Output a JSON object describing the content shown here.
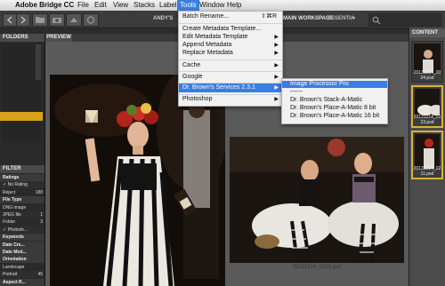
{
  "menubar": {
    "apple_glyph": "",
    "app": "Adobe Bridge CC",
    "items": [
      "File",
      "Edit",
      "View",
      "Stacks",
      "Label",
      "Tools",
      "Window",
      "Help"
    ]
  },
  "toolbar": {
    "breadcrumb": "ANDY'S",
    "workspace": "MAIN WORKSPACE",
    "workspace2": "ESSENTIA",
    "dropdown_glyph": "▾"
  },
  "left_panel": {
    "folders_tab": "FOLDERS",
    "filter_tab": "FILTER",
    "rows": [
      {
        "label": "Ratings",
        "count": "",
        "kind": "cat"
      },
      {
        "label": "✓ No Rating",
        "count": "",
        "kind": "row"
      },
      {
        "label": "Reject",
        "count": "188",
        "kind": "row"
      },
      {
        "label": "File Type",
        "count": "",
        "kind": "cat"
      },
      {
        "label": "DNG image",
        "count": "",
        "kind": "row"
      },
      {
        "label": "JPEG file",
        "count": "1",
        "kind": "row"
      },
      {
        "label": "Folder",
        "count": "3",
        "kind": "row"
      },
      {
        "label": "✓ Photosh...",
        "count": "",
        "kind": "row"
      },
      {
        "label": "Keywords",
        "count": "",
        "kind": "cat"
      },
      {
        "label": "Date Cre...",
        "count": "",
        "kind": "cat"
      },
      {
        "label": "Date Mod...",
        "count": "",
        "kind": "cat"
      },
      {
        "label": "Orientation",
        "count": "",
        "kind": "cat"
      },
      {
        "label": "Landscape",
        "count": "",
        "kind": "row"
      },
      {
        "label": "Portrait",
        "count": "45",
        "kind": "row"
      },
      {
        "label": "Aspect R...",
        "count": "",
        "kind": "cat"
      }
    ]
  },
  "preview": {
    "tab": "PREVIEW",
    "caption2": "20131214_0123.psd"
  },
  "content": {
    "tab": "CONTENT",
    "thumbs": [
      {
        "label": "20131214_00 24.psd",
        "selected": false
      },
      {
        "label": "20131214_01 23.psd",
        "selected": true
      },
      {
        "label": "20131214_02 11.psd",
        "selected": true
      }
    ]
  },
  "tools_menu": {
    "items": [
      {
        "label": "Batch Rename...",
        "shortcut": "⇧⌘R",
        "arrow": false,
        "highlight": false
      },
      {
        "label": "Create Metadata Template...",
        "shortcut": "",
        "arrow": false,
        "highlight": false
      },
      {
        "label": "Edit Metadata Template",
        "shortcut": "",
        "arrow": true,
        "highlight": false
      },
      {
        "label": "Append Metadata",
        "shortcut": "",
        "arrow": true,
        "highlight": false
      },
      {
        "label": "Replace Metadata",
        "shortcut": "",
        "arrow": true,
        "highlight": false
      },
      {
        "label": "Cache",
        "shortcut": "",
        "arrow": true,
        "highlight": false
      },
      {
        "label": "Google",
        "shortcut": "",
        "arrow": true,
        "highlight": false
      },
      {
        "label": "Dr. Brown's Services 2.3.1",
        "shortcut": "",
        "arrow": true,
        "highlight": true
      },
      {
        "label": "Photoshop",
        "shortcut": "",
        "arrow": true,
        "highlight": false
      }
    ],
    "arrow_glyph": "▶"
  },
  "submenu": {
    "items": [
      {
        "label": "Image Processor Pro",
        "highlight": true
      },
      {
        "label": "------",
        "highlight": false
      },
      {
        "label": "Dr. Brown's Stack-A-Matic",
        "highlight": false
      },
      {
        "label": "Dr. Brown's Place-A-Matic 8 bit",
        "highlight": false
      },
      {
        "label": "Dr. Brown's Place-A-Matic 16 bit",
        "highlight": false
      }
    ]
  }
}
